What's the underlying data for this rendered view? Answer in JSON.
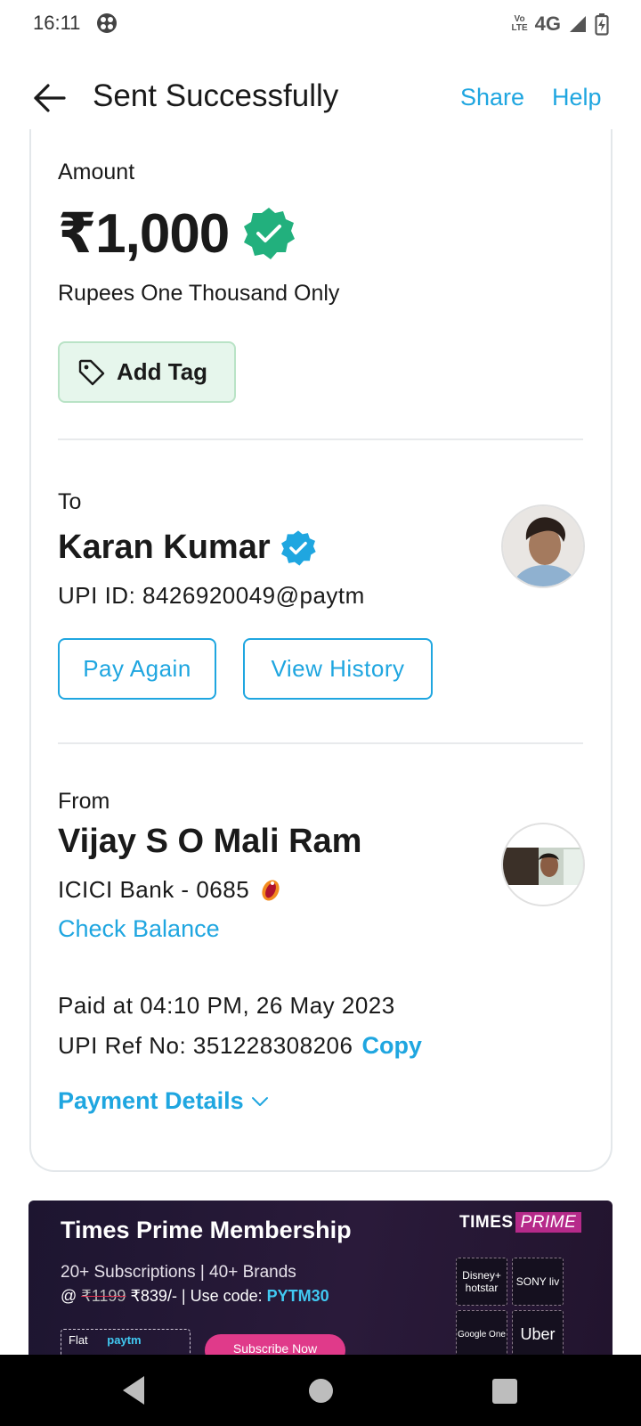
{
  "status_bar": {
    "time": "16:11",
    "volte_top": "VoLTE",
    "network": "4G",
    "icons": [
      "app-icon",
      "volte-icon",
      "signal-icon",
      "battery-charging-icon"
    ]
  },
  "header": {
    "title": "Sent Successfully",
    "share_label": "Share",
    "help_label": "Help",
    "back_icon": "arrow-left-icon"
  },
  "amount": {
    "label": "Amount",
    "value": "₹1,000",
    "in_words": "Rupees One Thousand Only",
    "verified_color": "#22b07d"
  },
  "tag": {
    "label": "Add Tag",
    "icon": "tag-icon"
  },
  "to": {
    "label": "To",
    "name": "Karan Kumar",
    "upi_id": "UPI ID: 8426920049@paytm",
    "pay_again_label": "Pay Again",
    "view_history_label": "View History",
    "verified_color": "#1fa6e0"
  },
  "from": {
    "label": "From",
    "name": "Vijay S O Mali Ram",
    "bank": "ICICI Bank - 0685",
    "check_balance_label": "Check Balance"
  },
  "transaction": {
    "paid_at": "Paid at 04:10 PM, 26 May 2023",
    "ref_no": "UPI Ref No: 351228308206",
    "copy_label": "Copy",
    "payment_details_label": "Payment Details"
  },
  "banner": {
    "title": "Times Prime Membership",
    "line1": "20+ Subscriptions | 40+ Brands",
    "price_prefix": "@ ",
    "old_price": "₹1199",
    "new_price": " ₹839/- | Use code: ",
    "code": "PYTM30",
    "brand_logo_text": "TIMES",
    "brand_logo_prime": "PRIME",
    "brand_hotstar": "Disney+ hotstar",
    "brand_sonyliv": "SONY liv",
    "brand_googleone": "Google One",
    "brand_uber": "Uber",
    "flat_label": "Flat",
    "flat_paytm": "paytm",
    "subscribe_label": "Subscribe Now"
  },
  "colors": {
    "accent": "#1fa6e0",
    "success": "#22b07d",
    "tag_bg": "#e6f6ec"
  }
}
